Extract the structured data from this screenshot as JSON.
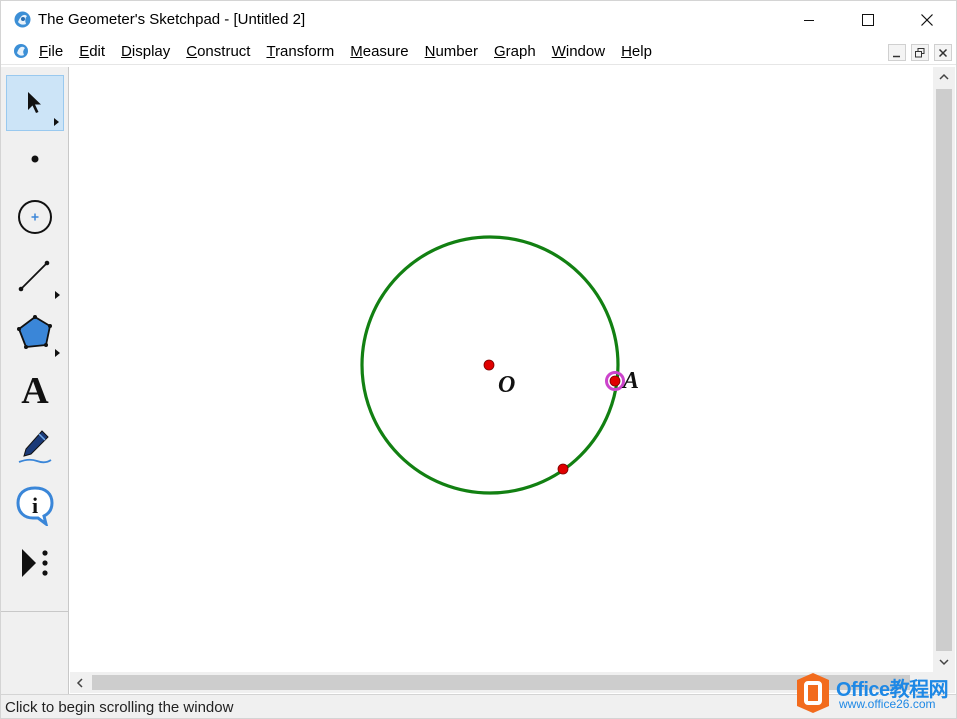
{
  "window": {
    "title": "The Geometer's Sketchpad - [Untitled 2]"
  },
  "menubar": {
    "items": [
      {
        "label": "File",
        "key": "F",
        "rest": "ile"
      },
      {
        "label": "Edit",
        "key": "E",
        "rest": "dit"
      },
      {
        "label": "Display",
        "key": "D",
        "rest": "isplay"
      },
      {
        "label": "Construct",
        "key": "C",
        "rest": "onstruct"
      },
      {
        "label": "Transform",
        "key": "T",
        "rest": "ransform"
      },
      {
        "label": "Measure",
        "key": "M",
        "rest": "easure"
      },
      {
        "label": "Number",
        "key": "N",
        "rest": "umber"
      },
      {
        "label": "Graph",
        "key": "G",
        "rest": "raph"
      },
      {
        "label": "Window",
        "key": "W",
        "rest": "indow"
      },
      {
        "label": "Help",
        "key": "H",
        "rest": "elp"
      }
    ]
  },
  "toolbox": {
    "tools": [
      {
        "name": "selection-arrow-tool",
        "icon": "arrow-icon",
        "selected": true
      },
      {
        "name": "point-tool",
        "icon": "point-icon",
        "selected": false
      },
      {
        "name": "compass-tool",
        "icon": "compass-icon",
        "selected": false
      },
      {
        "name": "straightedge-tool",
        "icon": "straightedge-icon",
        "selected": false
      },
      {
        "name": "polygon-tool",
        "icon": "polygon-icon",
        "selected": false
      },
      {
        "name": "text-tool",
        "icon": "text-icon",
        "selected": false
      },
      {
        "name": "marker-tool",
        "icon": "marker-icon",
        "selected": false
      },
      {
        "name": "information-tool",
        "icon": "info-icon",
        "selected": false
      },
      {
        "name": "custom-tools",
        "icon": "custom-tool-icon",
        "selected": false
      }
    ],
    "text_tool_glyph": "A",
    "info_tool_glyph": "i"
  },
  "sketch": {
    "center_label": "O",
    "point_label": "A",
    "circle_color": "#128012",
    "point_color": "#e00000",
    "selection_color": "#cc44cc"
  },
  "statusbar": {
    "text": "Click to begin scrolling the window"
  },
  "watermark": {
    "title": "Office教程网",
    "url": "www.office26.com",
    "color": "#1e88e5",
    "logo_color": "#f26b1d"
  }
}
